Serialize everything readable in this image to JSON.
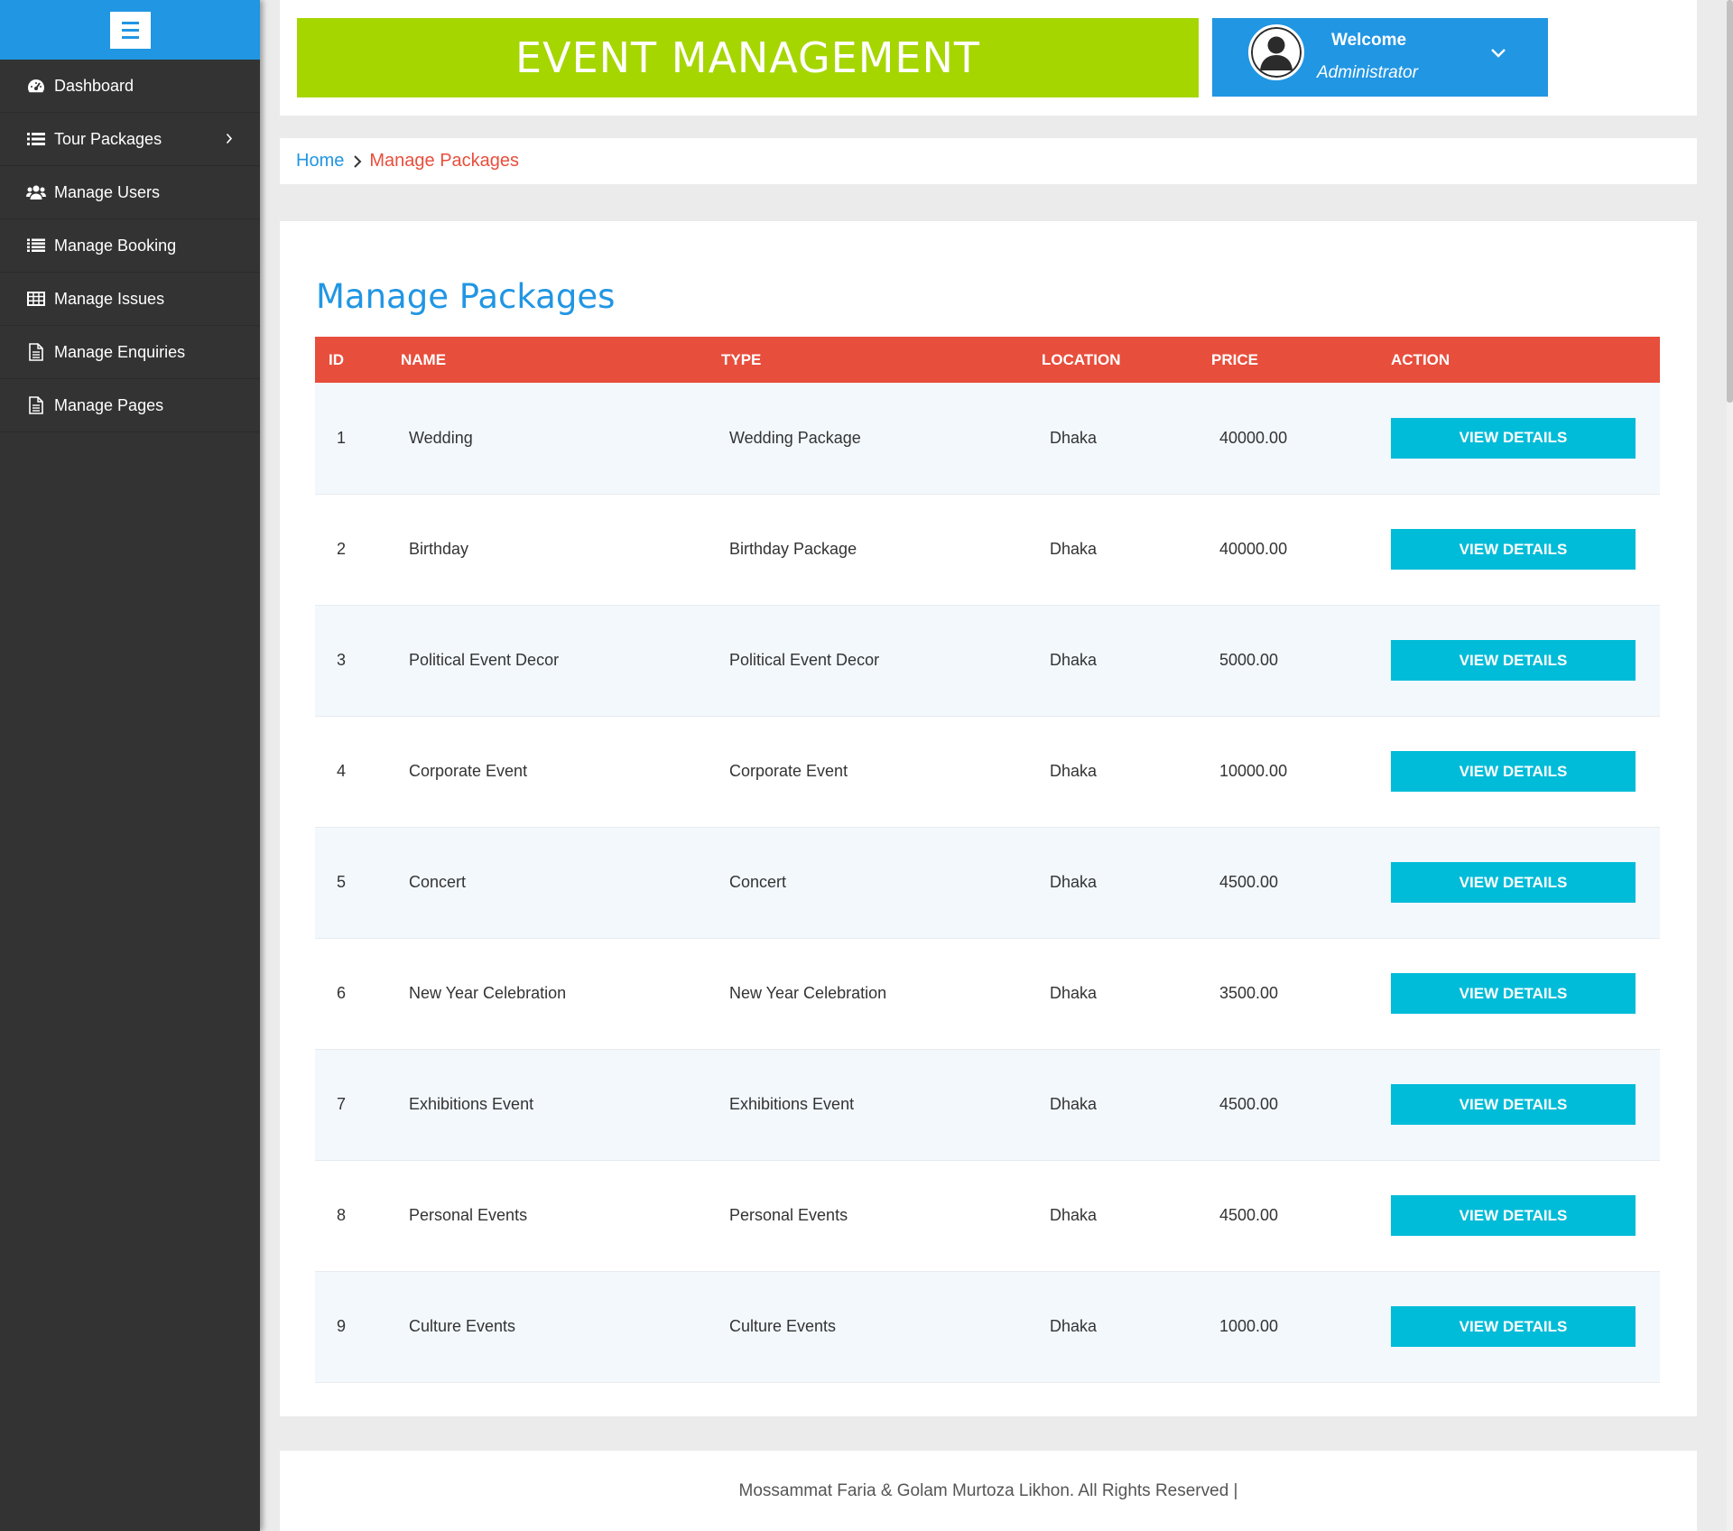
{
  "sidebar": {
    "items": [
      {
        "label": "Dashboard",
        "icon": "dashboard-icon"
      },
      {
        "label": "Tour Packages",
        "icon": "list-icon",
        "has_submenu": true
      },
      {
        "label": "Manage Users",
        "icon": "users-icon"
      },
      {
        "label": "Manage Booking",
        "icon": "list-icon"
      },
      {
        "label": "Manage Issues",
        "icon": "table-icon"
      },
      {
        "label": "Manage Enquiries",
        "icon": "file-icon"
      },
      {
        "label": "Manage Pages",
        "icon": "file-icon"
      }
    ]
  },
  "header": {
    "brand": "EVENT MANAGEMENT",
    "user": {
      "greeting": "Welcome",
      "role": "Administrator"
    }
  },
  "breadcrumb": {
    "home": "Home",
    "current": "Manage Packages"
  },
  "main": {
    "title": "Manage Packages",
    "columns": [
      "ID",
      "NAME",
      "TYPE",
      "LOCATION",
      "PRICE",
      "ACTION"
    ],
    "action_label": "VIEW DETAILS",
    "rows": [
      {
        "id": "1",
        "name": "Wedding",
        "type": "Wedding Package",
        "location": "Dhaka",
        "price": "40000.00"
      },
      {
        "id": "2",
        "name": "Birthday",
        "type": "Birthday Package",
        "location": "Dhaka",
        "price": "40000.00"
      },
      {
        "id": "3",
        "name": "Political Event Decor",
        "type": "Political Event Decor",
        "location": "Dhaka",
        "price": "5000.00"
      },
      {
        "id": "4",
        "name": "Corporate Event",
        "type": "Corporate Event",
        "location": "Dhaka",
        "price": "10000.00"
      },
      {
        "id": "5",
        "name": "Concert",
        "type": "Concert",
        "location": "Dhaka",
        "price": "4500.00"
      },
      {
        "id": "6",
        "name": "New Year Celebration",
        "type": "New Year Celebration",
        "location": "Dhaka",
        "price": "3500.00"
      },
      {
        "id": "7",
        "name": "Exhibitions Event",
        "type": "Exhibitions Event",
        "location": "Dhaka",
        "price": "4500.00"
      },
      {
        "id": "8",
        "name": "Personal Events",
        "type": "Personal Events",
        "location": "Dhaka",
        "price": "4500.00"
      },
      {
        "id": "9",
        "name": "Culture Events",
        "type": "Culture Events",
        "location": "Dhaka",
        "price": "1000.00"
      }
    ]
  },
  "footer": {
    "text": "Mossammat Faria & Golam Murtoza Likhon. All Rights Reserved |"
  },
  "colors": {
    "primary": "#2196e3",
    "brand_green": "#a6d600",
    "table_header": "#e84e3c",
    "action_button": "#00bcd8",
    "sidebar_bg": "#333333"
  }
}
